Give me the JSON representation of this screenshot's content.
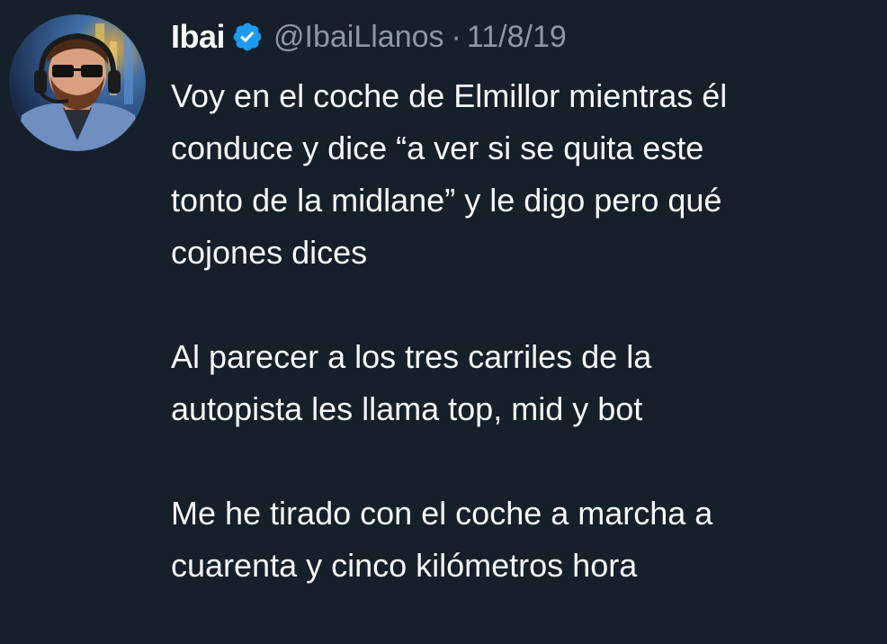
{
  "tweet": {
    "author": {
      "display_name": "Ibai",
      "handle": "@IbaiLlanos",
      "verified_icon": "verified-badge-icon",
      "avatar_icon": "avatar-photo"
    },
    "separator": "·",
    "date": "11/8/19",
    "paragraphs": [
      {
        "lines": [
          "Voy en el coche de Elmillor mientras él",
          "conduce y dice “a ver si se quita este",
          "tonto de la midlane” y le digo pero qué",
          "cojones dices"
        ]
      },
      {
        "lines": [
          "Al parecer a los tres carriles de la",
          "autopista les llama top, mid y bot"
        ]
      },
      {
        "lines": [
          "Me he tirado con el coche a marcha a",
          "cuarenta y cinco kilómetros hora"
        ]
      }
    ]
  },
  "colors": {
    "background": "#15202b",
    "text_primary": "#f7f9f9",
    "text_secondary": "#8b98a5",
    "verified_blue": "#1d9bf0"
  }
}
